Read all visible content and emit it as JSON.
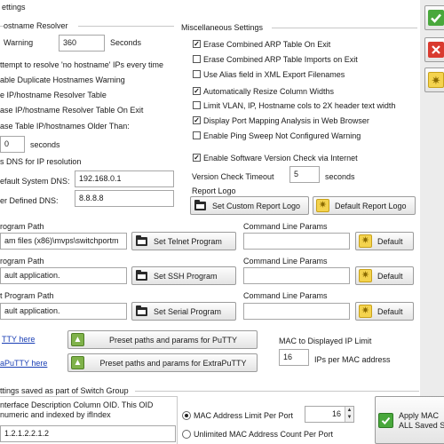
{
  "window": {
    "header": "ettings"
  },
  "hostname_resolver": {
    "group_title": "ostname Resolver",
    "warning_label": "Warning",
    "warning_value": "360",
    "warning_unit": "Seconds",
    "attempt_label": "ttempt to resolve 'no hostname' IPs every time",
    "duplicate_label": "able Duplicate Hostnames Warning",
    "table_label": "e IP/hostname Resolver Table",
    "erase_exit_label": "ase IP/hostname Resolver Table On Exit",
    "erase_older_label": "ase Table IP/hostnames Older Than:",
    "older_value": "0",
    "older_unit": "seconds",
    "dns_label": "s DNS for IP resolution",
    "default_dns_label": "efault System DNS:",
    "default_dns_value": "192.168.0.1",
    "user_dns_label": "er Defined DNS:",
    "user_dns_value": "8.8.8.8"
  },
  "misc": {
    "group_title": "Miscellaneous Settings",
    "checkboxes": [
      {
        "label": "Erase Combined ARP Table On Exit",
        "checked": true
      },
      {
        "label": "Erase Combined ARP Table Imports on Exit",
        "checked": false
      },
      {
        "label": "Use Alias field in XML Export Filenames",
        "checked": false
      },
      {
        "label": "Automatically Resize Column Widths",
        "checked": true
      },
      {
        "label": "Limit VLAN, IP, Hostname cols to 2X header text width",
        "checked": false
      },
      {
        "label": "Display Port Mapping Analysis in Web Browser",
        "checked": true
      },
      {
        "label": "Enable Ping Sweep Not Configured Warning",
        "checked": false
      },
      {
        "label": "Enable Software Version Check via Internet",
        "checked": true
      }
    ],
    "version_timeout_label": "Version Check Timeout",
    "version_timeout_value": "5",
    "version_timeout_unit": "seconds",
    "report_logo_label": "Report Logo",
    "set_custom_logo_button": "Set Custom Report Logo",
    "default_logo_button": "Default Report Logo"
  },
  "programs": {
    "command_line_params_label": "Command Line Params",
    "default_button": "Default",
    "telnet": {
      "path_label": "rogram Path",
      "path_value": "am files (x86)\\mvps\\switchportm",
      "set_button": "Set Telnet Program",
      "params_value": ""
    },
    "ssh": {
      "path_label": "rogram Path",
      "path_value": "ault application.",
      "set_button": "Set SSH Program",
      "params_value": ""
    },
    "serial": {
      "path_label": "t Program Path",
      "path_value": "ault application.",
      "set_button": "Set Serial Program",
      "params_value": ""
    }
  },
  "putty": {
    "putty_link": "TTY here",
    "putty_button": "Preset paths and params for PuTTY",
    "extraputty_link": "aPuTTY here",
    "extraputty_button": "Preset paths and params for ExtraPuTTY"
  },
  "mac_limit": {
    "label": "MAC to Displayed IP Limit",
    "value": "16",
    "unit": "IPs per MAC address"
  },
  "switch_group": {
    "title": "ttings saved as part of Switch Group",
    "oid_line1": "nterface Description Column OID. This OID",
    "oid_line2": "numeric and indexed by ifIndex",
    "oid_value": "1.2.1.2.2.1.2",
    "mac_limit_radio": "MAC Address Limit Per Port",
    "mac_limit_value": "16",
    "unlimited_radio": "Unlimited MAC Address Count Per Port",
    "apply_line1": "Apply MAC",
    "apply_line2": "ALL Saved S"
  },
  "sidebar": {
    "ok_icon": "check-icon",
    "cancel_icon": "close-icon",
    "default_icon": "gear-icon"
  }
}
